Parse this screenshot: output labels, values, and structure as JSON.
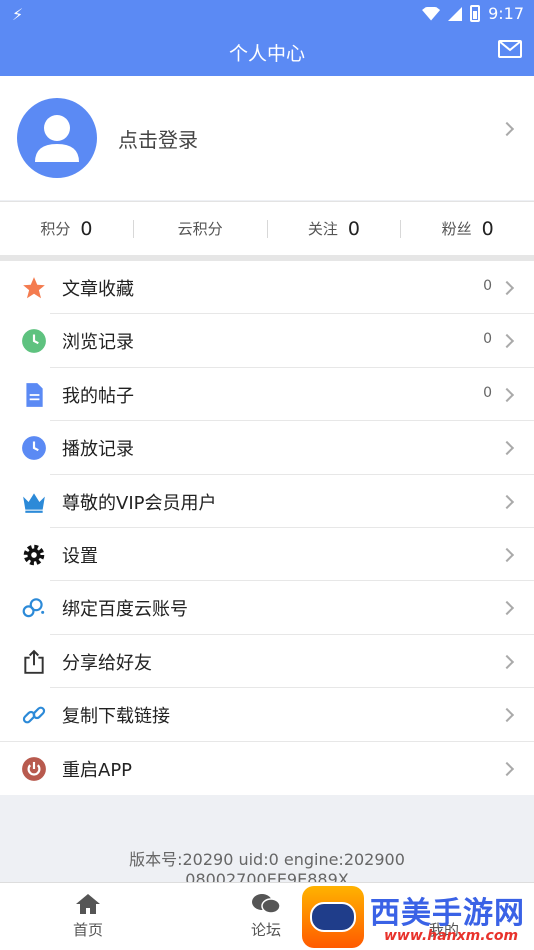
{
  "status_bar": {
    "time": "9:17"
  },
  "header": {
    "title": "个人中心",
    "mail_icon": "mail-icon"
  },
  "profile": {
    "login_text": "点击登录",
    "avatar_icon": "user-avatar-icon"
  },
  "stats": [
    {
      "label": "积分",
      "value": "0"
    },
    {
      "label": "云积分",
      "value": ""
    },
    {
      "label": "关注",
      "value": "0"
    },
    {
      "label": "粉丝",
      "value": "0"
    }
  ],
  "menu": [
    {
      "label": "文章收藏",
      "count": "0",
      "icon": "star-icon",
      "color": "#f47b4f"
    },
    {
      "label": "浏览记录",
      "count": "0",
      "icon": "clock-icon",
      "color": "#5ec27f"
    },
    {
      "label": "我的帖子",
      "count": "0",
      "icon": "document-icon",
      "color": "#5b8af4"
    },
    {
      "label": "播放记录",
      "count": "",
      "icon": "clock-icon",
      "color": "#5b8af4"
    },
    {
      "label": "尊敬的VIP会员用户",
      "count": "",
      "icon": "crown-icon",
      "color": "#2c8ad8"
    },
    {
      "label": "设置",
      "count": "",
      "icon": "gear-icon",
      "color": "#111111"
    },
    {
      "label": "绑定百度云账号",
      "count": "",
      "icon": "cloud-link-icon",
      "color": "#2c8ad8"
    },
    {
      "label": "分享给好友",
      "count": "",
      "icon": "share-icon",
      "color": "#333333"
    },
    {
      "label": "复制下载链接",
      "count": "",
      "icon": "link-icon",
      "color": "#2c8ad8"
    },
    {
      "label": "重启APP",
      "count": "",
      "icon": "power-icon",
      "color": "#b85a4e"
    }
  ],
  "version_text": "版本号:20290 uid:0 engine:202900",
  "version_text_2": "08002700EE9E889X",
  "tabs": [
    {
      "label": "首页",
      "icon": "home-icon"
    },
    {
      "label": "论坛",
      "icon": "chat-icon"
    },
    {
      "label": "我的",
      "icon": "user-icon"
    }
  ],
  "watermark": {
    "title": "西美手游网",
    "url": "www.hanxm.com"
  },
  "colors": {
    "primary": "#5b8af4",
    "background": "#eef0f4"
  }
}
